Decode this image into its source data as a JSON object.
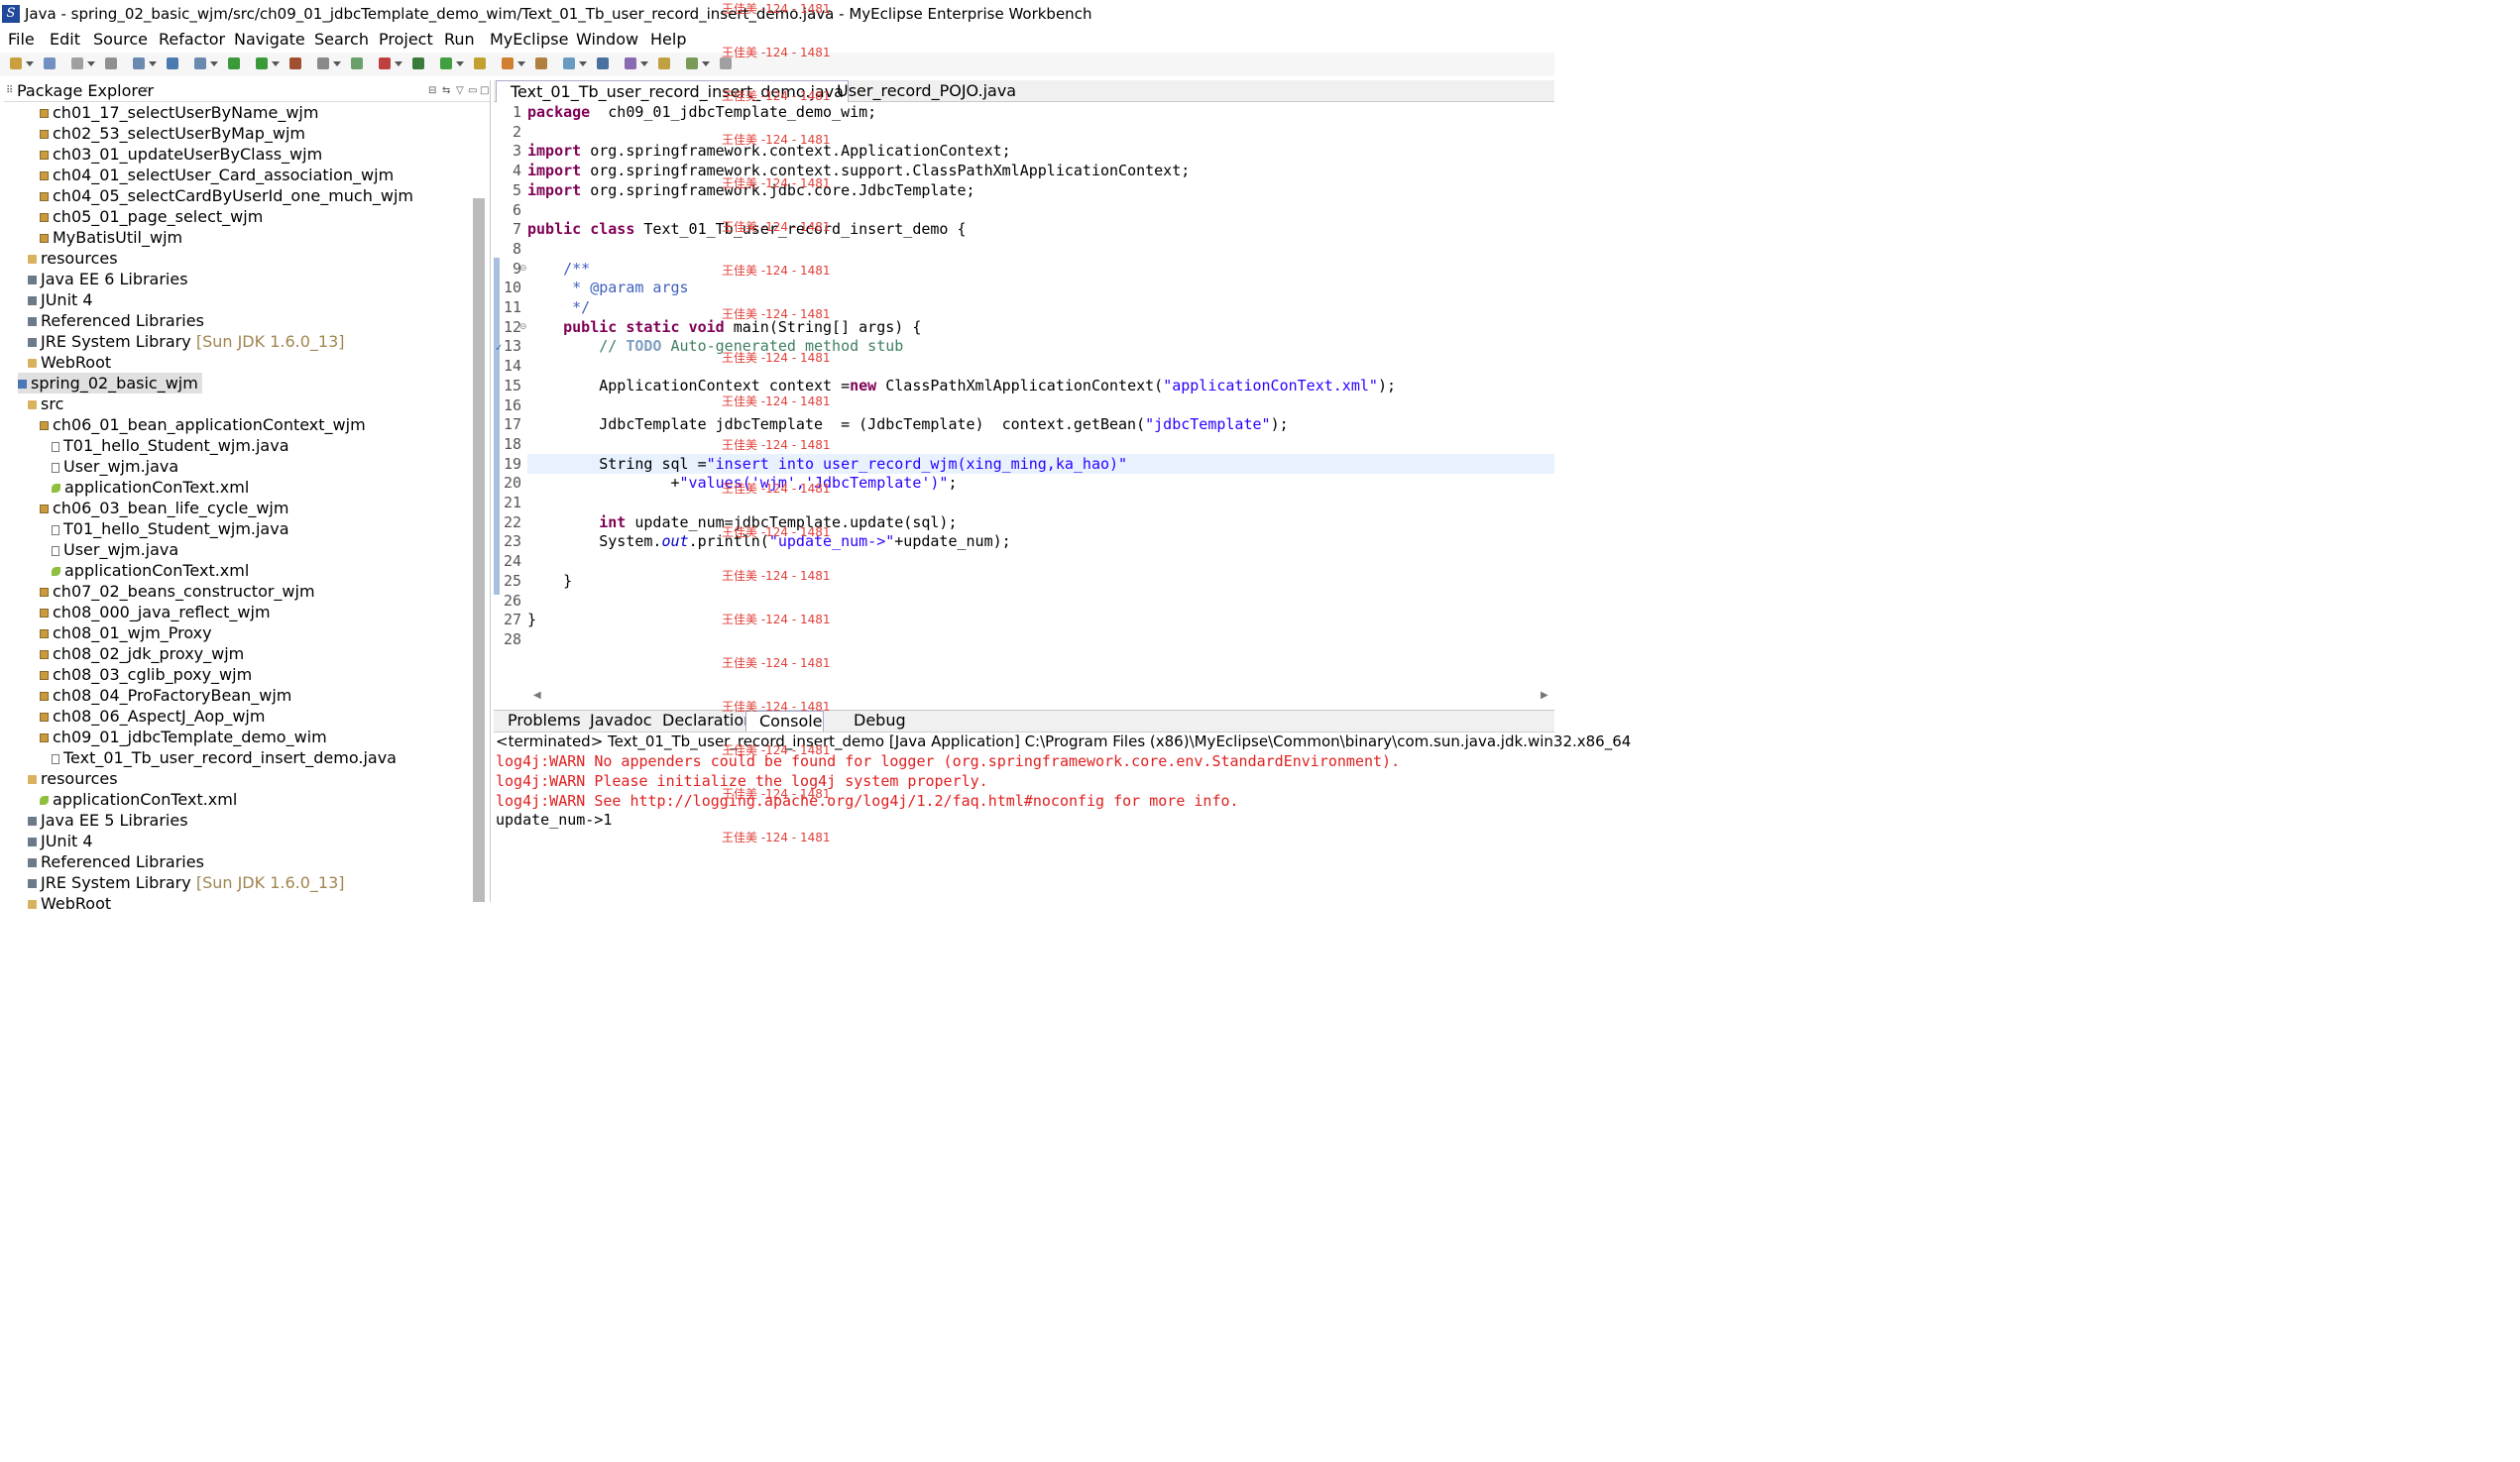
{
  "window": {
    "title": "Java - spring_02_basic_wjm/src/ch09_01_jdbcTemplate_demo_wim/Text_01_Tb_user_record_insert_demo.java - MyEclipse Enterprise Workbench"
  },
  "menu": [
    "File",
    "Edit",
    "Source",
    "Refactor",
    "Navigate",
    "Search",
    "Project",
    "Run",
    "MyEclipse",
    "Window",
    "Help"
  ],
  "package_explorer": {
    "title": "Package Explorer",
    "items": [
      {
        "label": "ch01_17_selectUserByName_wjm",
        "icon": "package-icon",
        "indent": 3
      },
      {
        "label": "ch02_53_selectUserByMap_wjm",
        "icon": "package-icon",
        "indent": 3
      },
      {
        "label": "ch03_01_updateUserByClass_wjm",
        "icon": "package-icon",
        "indent": 3
      },
      {
        "label": "ch04_01_selectUser_Card_association_wjm",
        "icon": "package-icon",
        "indent": 3
      },
      {
        "label": "ch04_05_selectCardByUserId_one_much_wjm",
        "icon": "package-icon",
        "indent": 3
      },
      {
        "label": "ch05_01_page_select_wjm",
        "icon": "package-icon",
        "indent": 3
      },
      {
        "label": "MyBatisUtil_wjm",
        "icon": "package-icon",
        "indent": 3
      },
      {
        "label": "resources",
        "icon": "folder-icon",
        "indent": 2
      },
      {
        "label": "Java EE 6 Libraries",
        "icon": "library-icon",
        "indent": 2
      },
      {
        "label": "JUnit 4",
        "icon": "library-icon",
        "indent": 2
      },
      {
        "label": "Referenced Libraries",
        "icon": "library-icon",
        "indent": 2
      },
      {
        "label": "JRE System Library",
        "suffix": "[Sun JDK 1.6.0_13]",
        "icon": "library-icon",
        "indent": 2
      },
      {
        "label": "WebRoot",
        "icon": "folder-icon",
        "indent": 2
      },
      {
        "label": "spring_02_basic_wjm",
        "icon": "project-icon",
        "indent": 1,
        "selected": true
      },
      {
        "label": "src",
        "icon": "folder-icon",
        "indent": 2
      },
      {
        "label": "ch06_01_bean_applicationContext_wjm",
        "icon": "package-icon",
        "indent": 3
      },
      {
        "label": "T01_hello_Student_wjm.java",
        "icon": "java-file-icon",
        "indent": 4
      },
      {
        "label": "User_wjm.java",
        "icon": "java-file-icon",
        "indent": 4
      },
      {
        "label": "applicationConText.xml",
        "icon": "xml-file-icon",
        "indent": 4
      },
      {
        "label": "ch06_03_bean_life_cycle_wjm",
        "icon": "package-icon",
        "indent": 3
      },
      {
        "label": "T01_hello_Student_wjm.java",
        "icon": "java-file-icon",
        "indent": 4
      },
      {
        "label": "User_wjm.java",
        "icon": "java-file-icon",
        "indent": 4
      },
      {
        "label": "applicationConText.xml",
        "icon": "xml-file-icon",
        "indent": 4
      },
      {
        "label": "ch07_02_beans_constructor_wjm",
        "icon": "package-icon",
        "indent": 3
      },
      {
        "label": "ch08_000_java_reflect_wjm",
        "icon": "package-icon",
        "indent": 3
      },
      {
        "label": "ch08_01_wjm_Proxy",
        "icon": "package-icon",
        "indent": 3
      },
      {
        "label": "ch08_02_jdk_proxy_wjm",
        "icon": "package-icon",
        "indent": 3
      },
      {
        "label": "ch08_03_cglib_poxy_wjm",
        "icon": "package-icon",
        "indent": 3
      },
      {
        "label": "ch08_04_ProFactoryBean_wjm",
        "icon": "package-icon",
        "indent": 3
      },
      {
        "label": "ch08_06_AspectJ_Aop_wjm",
        "icon": "package-icon",
        "indent": 3
      },
      {
        "label": "ch09_01_jdbcTemplate_demo_wim",
        "icon": "package-icon",
        "indent": 3
      },
      {
        "label": "Text_01_Tb_user_record_insert_demo.java",
        "icon": "java-file-icon",
        "indent": 4
      },
      {
        "label": "resources",
        "icon": "folder-icon",
        "indent": 2
      },
      {
        "label": "applicationConText.xml",
        "icon": "xml-file-icon",
        "indent": 3
      },
      {
        "label": "Java EE 5 Libraries",
        "icon": "library-icon",
        "indent": 2
      },
      {
        "label": "JUnit 4",
        "icon": "library-icon",
        "indent": 2
      },
      {
        "label": "Referenced Libraries",
        "icon": "library-icon",
        "indent": 2
      },
      {
        "label": "JRE System Library",
        "suffix": "[Sun JDK 1.6.0_13]",
        "icon": "library-icon",
        "indent": 2
      },
      {
        "label": "WebRoot",
        "icon": "folder-icon",
        "indent": 2
      }
    ]
  },
  "editor": {
    "tabs": [
      {
        "label": "Text_01_Tb_user_record_insert_demo.java",
        "active": true
      },
      {
        "label": "User_record_POJO.java",
        "active": false
      }
    ],
    "lines": [
      [
        [
          "kw",
          "package"
        ],
        [
          "",
          "  ch09_01_jdbcTemplate_demo_wim;"
        ]
      ],
      [],
      [
        [
          "kw",
          "import"
        ],
        [
          "",
          " org.springframework.context.ApplicationContext;"
        ]
      ],
      [
        [
          "kw",
          "import"
        ],
        [
          "",
          " org.springframework.context.support.ClassPathXmlApplicationContext;"
        ]
      ],
      [
        [
          "kw",
          "import"
        ],
        [
          "",
          " org.springframework.jdbc.core.JdbcTemplate;"
        ]
      ],
      [],
      [
        [
          "kw",
          "public"
        ],
        [
          "",
          " "
        ],
        [
          "kw",
          "class"
        ],
        [
          "",
          " Text_01_Tb_user_record_insert_demo {"
        ]
      ],
      [],
      [
        [
          "",
          "    "
        ],
        [
          "cmt",
          "/**"
        ]
      ],
      [
        [
          "",
          "     "
        ],
        [
          "cmt",
          "* "
        ],
        [
          "cmt",
          "@param"
        ],
        [
          "cmt",
          " args"
        ]
      ],
      [
        [
          "",
          "     "
        ],
        [
          "cmt",
          "*/"
        ]
      ],
      [
        [
          "",
          "    "
        ],
        [
          "kw",
          "public"
        ],
        [
          "",
          " "
        ],
        [
          "kw",
          "static"
        ],
        [
          "",
          " "
        ],
        [
          "kw",
          "void"
        ],
        [
          "",
          " main(String[] args) {"
        ]
      ],
      [
        [
          "",
          "        "
        ],
        [
          "lcmt",
          "// "
        ],
        [
          "todo",
          "TODO"
        ],
        [
          "lcmt",
          " Auto-generated method stub"
        ]
      ],
      [],
      [
        [
          "",
          "        ApplicationContext context ="
        ],
        [
          "kw",
          "new"
        ],
        [
          "",
          " ClassPathXmlApplicationContext("
        ],
        [
          "str",
          "\"applicationConText.xml\""
        ],
        [
          "",
          ");"
        ]
      ],
      [],
      [
        [
          "",
          "        JdbcTemplate jdbcTemplate  = (JdbcTemplate)  context.getBean("
        ],
        [
          "str",
          "\"jdbcTemplate\""
        ],
        [
          "",
          ");"
        ]
      ],
      [],
      [
        [
          "",
          "        String sql ="
        ],
        [
          "str",
          "\"insert into user_record_wjm(xing_ming,ka_hao)\""
        ]
      ],
      [
        [
          "",
          "                +"
        ],
        [
          "str",
          "\"values('wjm','JdbcTemplate')\""
        ],
        [
          "",
          ";"
        ]
      ],
      [],
      [
        [
          "",
          "        "
        ],
        [
          "kw",
          "int"
        ],
        [
          "",
          " update_num=jdbcTemplate.update(sql);"
        ]
      ],
      [
        [
          "",
          "        System."
        ],
        [
          "ital",
          "out"
        ],
        [
          "",
          ".println("
        ],
        [
          "str",
          "\"update_num->\""
        ],
        [
          "",
          "+update_num);"
        ]
      ],
      [],
      [
        [
          "",
          "    }"
        ]
      ],
      [],
      [
        [
          "",
          "}"
        ]
      ],
      []
    ]
  },
  "console": {
    "tabs": [
      "Problems",
      "Javadoc",
      "Declaration",
      "Console",
      "Debug"
    ],
    "active_tab": "Console",
    "status": "<terminated> Text_01_Tb_user_record_insert_demo [Java Application] C:\\Program Files (x86)\\MyEclipse\\Common\\binary\\com.sun.java.jdk.win32.x86_64",
    "lines": [
      {
        "text": "log4j:WARN No appenders could be found for logger (org.springframework.core.env.StandardEnvironment).",
        "color": "#e02020"
      },
      {
        "text": "log4j:WARN Please initialize the log4j system properly.",
        "color": "#e02020"
      },
      {
        "text": "log4j:WARN See http://logging.apache.org/log4j/1.2/faq.html#noconfig for more info.",
        "color": "#e02020"
      },
      {
        "text": "update_num->1",
        "color": "#000000"
      }
    ]
  },
  "watermark": "王佳美 -124 - 1481"
}
